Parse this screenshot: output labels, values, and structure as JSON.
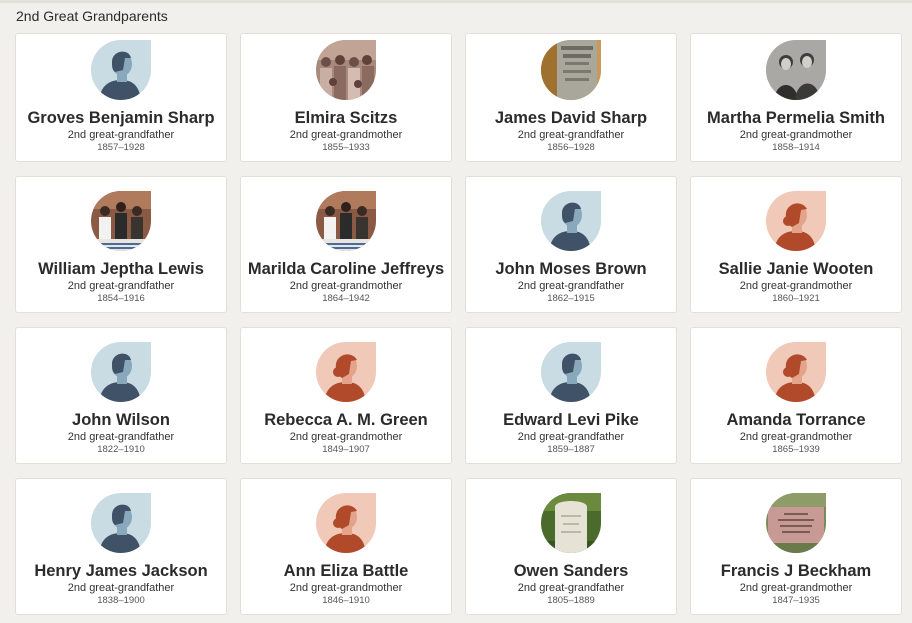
{
  "section": {
    "title": "2nd Great Grandparents"
  },
  "cards": [
    {
      "name": "Groves Benjamin Sharp",
      "relation": "2nd great-grandfather",
      "dates": "1857–1928",
      "avatar": "male-silhouette-icon"
    },
    {
      "name": "Elmira Scitzs",
      "relation": "2nd great-grandmother",
      "dates": "1855–1933",
      "avatar": "group-photo"
    },
    {
      "name": "James David Sharp",
      "relation": "2nd great-grandfather",
      "dates": "1856–1928",
      "avatar": "gravestone-photo"
    },
    {
      "name": "Martha Permelia Smith",
      "relation": "2nd great-grandmother",
      "dates": "1858–1914",
      "avatar": "couple-photo"
    },
    {
      "name": "William Jeptha Lewis",
      "relation": "2nd great-grandfather",
      "dates": "1854–1916",
      "avatar": "family-photo"
    },
    {
      "name": "Marilda Caroline Jeffreys",
      "relation": "2nd great-grandmother",
      "dates": "1864–1942",
      "avatar": "family-photo"
    },
    {
      "name": "John Moses Brown",
      "relation": "2nd great-grandfather",
      "dates": "1862–1915",
      "avatar": "male-silhouette-icon"
    },
    {
      "name": "Sallie Janie Wooten",
      "relation": "2nd great-grandmother",
      "dates": "1860–1921",
      "avatar": "female-silhouette-icon"
    },
    {
      "name": "John Wilson",
      "relation": "2nd great-grandfather",
      "dates": "1822–1910",
      "avatar": "male-silhouette-icon"
    },
    {
      "name": "Rebecca A. M. Green",
      "relation": "2nd great-grandmother",
      "dates": "1849–1907",
      "avatar": "female-silhouette-icon"
    },
    {
      "name": "Edward Levi Pike",
      "relation": "2nd great-grandfather",
      "dates": "1859–1887",
      "avatar": "male-silhouette-icon"
    },
    {
      "name": "Amanda Torrance",
      "relation": "2nd great-grandmother",
      "dates": "1865–1939",
      "avatar": "female-silhouette-icon"
    },
    {
      "name": "Henry James Jackson",
      "relation": "2nd great-grandfather",
      "dates": "1838–1900",
      "avatar": "male-silhouette-icon"
    },
    {
      "name": "Ann Eliza Battle",
      "relation": "2nd great-grandmother",
      "dates": "1846–1910",
      "avatar": "female-silhouette-icon"
    },
    {
      "name": "Owen Sanders",
      "relation": "2nd great-grandfather",
      "dates": "1805–1889",
      "avatar": "headstone-photo"
    },
    {
      "name": "Francis J Beckham",
      "relation": "2nd great-grandmother",
      "dates": "1847–1935",
      "avatar": "grave-marker-photo"
    }
  ],
  "colors": {
    "page_bg": "#f2f0ec",
    "card_bg": "#ffffff",
    "male_avatar_bg": "#c9dbe3",
    "male_figure": "#3f5268",
    "male_face": "#8aa8bb",
    "female_avatar_bg": "#f0c9b8",
    "female_figure": "#b14a2a",
    "female_face": "#e3a48b"
  }
}
